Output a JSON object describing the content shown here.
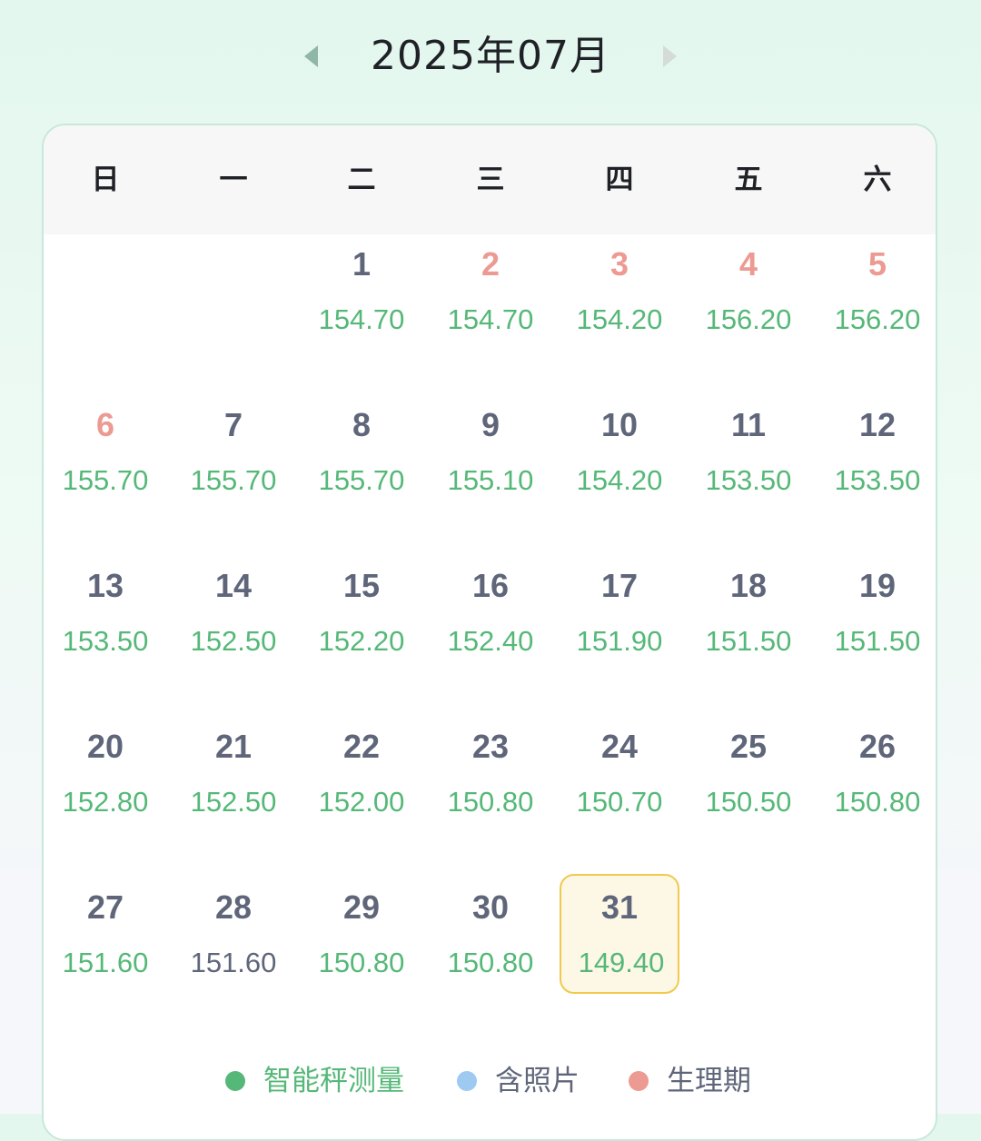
{
  "header": {
    "month_title": "2025年07月",
    "prev_icon": "caret-left-icon",
    "next_icon": "caret-right-icon",
    "prev_color": "#8fb6a6",
    "next_color": "#d4dcd8"
  },
  "calendar": {
    "weekdays": [
      "日",
      "一",
      "二",
      "三",
      "四",
      "五",
      "六"
    ],
    "first_weekday_index": 2,
    "today": 31,
    "days": [
      {
        "day": "1",
        "weight": "154.70",
        "period": false
      },
      {
        "day": "2",
        "weight": "154.70",
        "period": true
      },
      {
        "day": "3",
        "weight": "154.20",
        "period": true
      },
      {
        "day": "4",
        "weight": "156.20",
        "period": true
      },
      {
        "day": "5",
        "weight": "156.20",
        "period": true
      },
      {
        "day": "6",
        "weight": "155.70",
        "period": true
      },
      {
        "day": "7",
        "weight": "155.70",
        "period": false
      },
      {
        "day": "8",
        "weight": "155.70",
        "period": false
      },
      {
        "day": "9",
        "weight": "155.10",
        "period": false
      },
      {
        "day": "10",
        "weight": "154.20",
        "period": false
      },
      {
        "day": "11",
        "weight": "153.50",
        "period": false
      },
      {
        "day": "12",
        "weight": "153.50",
        "period": false
      },
      {
        "day": "13",
        "weight": "153.50",
        "period": false
      },
      {
        "day": "14",
        "weight": "152.50",
        "period": false
      },
      {
        "day": "15",
        "weight": "152.20",
        "period": false
      },
      {
        "day": "16",
        "weight": "152.40",
        "period": false
      },
      {
        "day": "17",
        "weight": "151.90",
        "period": false
      },
      {
        "day": "18",
        "weight": "151.50",
        "period": false
      },
      {
        "day": "19",
        "weight": "151.50",
        "period": false
      },
      {
        "day": "20",
        "weight": "152.80",
        "period": false
      },
      {
        "day": "21",
        "weight": "152.50",
        "period": false
      },
      {
        "day": "22",
        "weight": "152.00",
        "period": false
      },
      {
        "day": "23",
        "weight": "150.80",
        "period": false
      },
      {
        "day": "24",
        "weight": "150.70",
        "period": false
      },
      {
        "day": "25",
        "weight": "150.50",
        "period": false
      },
      {
        "day": "26",
        "weight": "150.80",
        "period": false
      },
      {
        "day": "27",
        "weight": "151.60",
        "period": false
      },
      {
        "day": "28",
        "weight": "151.60",
        "period": false,
        "smart_scale": false
      },
      {
        "day": "29",
        "weight": "150.80",
        "period": false
      },
      {
        "day": "30",
        "weight": "150.80",
        "period": false
      },
      {
        "day": "31",
        "weight": "149.40",
        "period": false
      }
    ]
  },
  "colors": {
    "weight_green": "#56b878",
    "day_gray": "#5f667a",
    "period_pink": "#ec9a92",
    "today_bg": "#fdf7e6",
    "today_border": "#f1c94b"
  },
  "legend": [
    {
      "label": "智能秤测量",
      "dot_color": "#56b878",
      "text_color": "#56b878"
    },
    {
      "label": "含照片",
      "dot_color": "#9ec9f1",
      "text_color": "#5f667a"
    },
    {
      "label": "生理期",
      "dot_color": "#ec9a92",
      "text_color": "#5f667a"
    }
  ]
}
